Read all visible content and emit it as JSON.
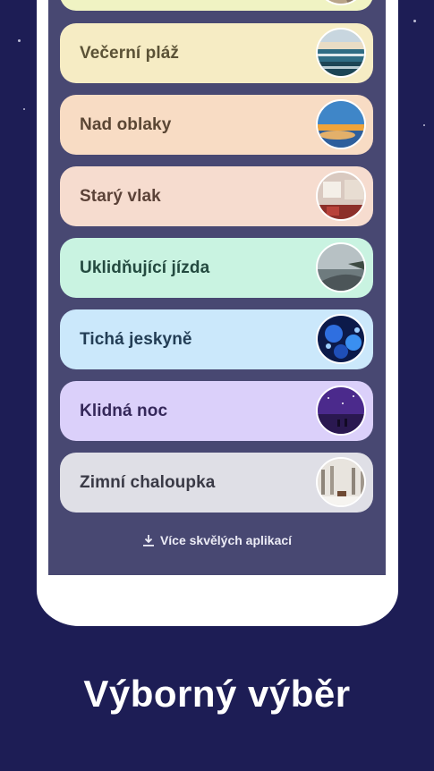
{
  "items": [
    {
      "label": "",
      "bg": "#f0f3c3",
      "text_color": "#3d3d2c",
      "thumb": "top-partial-thumbnail"
    },
    {
      "label": "Večerní pláž",
      "bg": "#f6ecc4",
      "text_color": "#5b5236",
      "thumb": "evening-beach-thumbnail"
    },
    {
      "label": "Nad oblaky",
      "bg": "#f8dcc4",
      "text_color": "#5a4634",
      "thumb": "above-clouds-thumbnail"
    },
    {
      "label": "Starý vlak",
      "bg": "#f6dccf",
      "text_color": "#5b4238",
      "thumb": "old-train-thumbnail"
    },
    {
      "label": "Uklidňující jízda",
      "bg": "#c9f3e1",
      "text_color": "#244a40",
      "thumb": "calming-ride-thumbnail"
    },
    {
      "label": "Tichá jeskyně",
      "bg": "#cbe8fb",
      "text_color": "#223d55",
      "thumb": "quiet-cave-thumbnail"
    },
    {
      "label": "Klidná noc",
      "bg": "#dbd0fa",
      "text_color": "#35285a",
      "thumb": "calm-night-thumbnail"
    },
    {
      "label": "Zimní chaloupka",
      "bg": "#dfdfe6",
      "text_color": "#3a3a46",
      "thumb": "winter-cottage-thumbnail"
    }
  ],
  "more_apps": {
    "label": "Více skvělých aplikací",
    "icon": "download-icon"
  },
  "headline": "Výborný výběr",
  "colors": {
    "background": "#1d1d55",
    "screen": "#484872",
    "device": "#ffffff"
  }
}
